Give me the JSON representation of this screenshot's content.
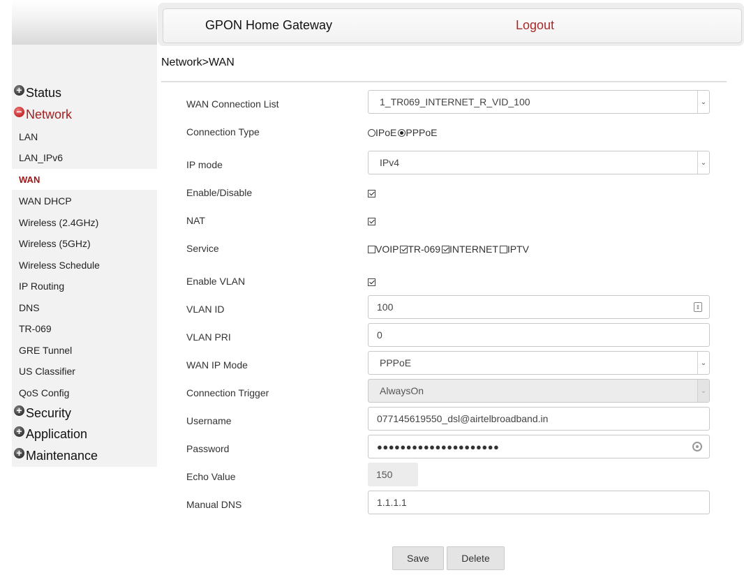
{
  "header": {
    "title": "GPON Home Gateway",
    "logout": "Logout"
  },
  "breadcrumb": "Network>WAN",
  "sidebar": {
    "categories": {
      "status": "Status",
      "network": "Network",
      "security": "Security",
      "application": "Application",
      "maintenance": "Maintenance"
    },
    "network_items": [
      "LAN",
      "LAN_IPv6",
      "WAN",
      "WAN DHCP",
      "Wireless (2.4GHz)",
      "Wireless (5GHz)",
      "Wireless Schedule",
      "IP Routing",
      "DNS",
      "TR-069",
      "GRE Tunnel",
      "US Classifier",
      "QoS Config"
    ],
    "active_item": "WAN"
  },
  "form": {
    "wan_connection_list": {
      "label": "WAN Connection List",
      "value": "1_TR069_INTERNET_R_VID_100"
    },
    "connection_type": {
      "label": "Connection Type",
      "options": [
        "IPoE",
        "PPPoE"
      ],
      "selected": "PPPoE"
    },
    "ip_mode": {
      "label": "IP mode",
      "value": "IPv4"
    },
    "enable_disable": {
      "label": "Enable/Disable",
      "checked": true
    },
    "nat": {
      "label": "NAT",
      "checked": true
    },
    "service": {
      "label": "Service",
      "options": [
        {
          "name": "VOIP",
          "checked": false
        },
        {
          "name": "TR-069",
          "checked": true
        },
        {
          "name": "INTERNET",
          "checked": true
        },
        {
          "name": "IPTV",
          "checked": false
        }
      ]
    },
    "enable_vlan": {
      "label": "Enable VLAN",
      "checked": true
    },
    "vlan_id": {
      "label": "VLAN ID",
      "value": "100"
    },
    "vlan_pri": {
      "label": "VLAN PRI",
      "value": "0"
    },
    "wan_ip_mode": {
      "label": "WAN IP Mode",
      "value": "PPPoE"
    },
    "connection_trigger": {
      "label": "Connection Trigger",
      "value": "AlwaysOn"
    },
    "username": {
      "label": "Username",
      "value": "077145619550_dsl@airtelbroadband.in"
    },
    "password": {
      "label": "Password",
      "masked": "●●●●●●●●●●●●●●●●●●●●●"
    },
    "echo_value": {
      "label": "Echo Value",
      "value": "150"
    },
    "manual_dns": {
      "label": "Manual DNS",
      "value": "1.1.1.1"
    }
  },
  "buttons": {
    "save": "Save",
    "delete": "Delete"
  },
  "icons": {
    "expand": "plus-circle-icon",
    "collapse": "minus-circle-icon",
    "dropdown": "chevron-down-icon",
    "spinner": "number-spinner-icon",
    "reveal": "eye-icon"
  },
  "colors": {
    "active_red": "#a52020",
    "logout_red": "#a52a2a",
    "sidebar_bg": "#f2f2f2"
  }
}
